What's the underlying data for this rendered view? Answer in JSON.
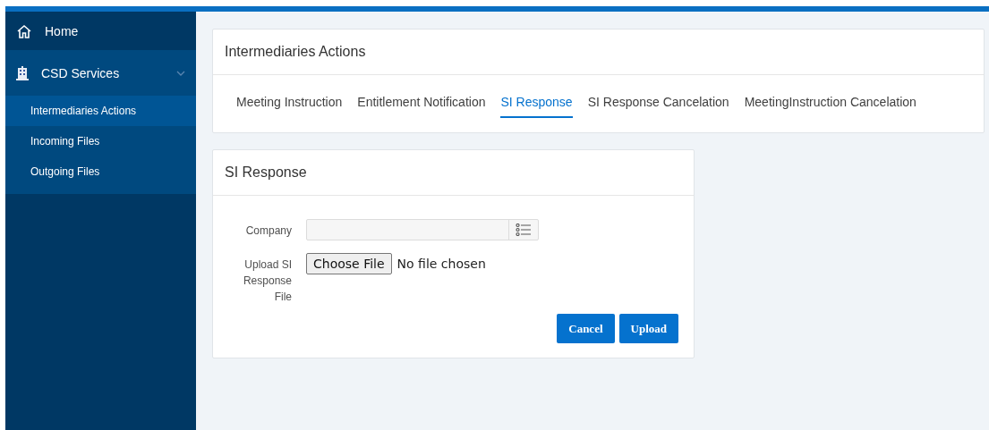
{
  "sidebar": {
    "items": [
      {
        "kind": "link",
        "label": "Home"
      },
      {
        "kind": "group",
        "label": "CSD Services",
        "expanded": true,
        "children": [
          {
            "label": "Intermediaries Actions",
            "selected": true
          },
          {
            "label": "Incoming Files",
            "selected": false
          },
          {
            "label": "Outgoing Files",
            "selected": false
          }
        ]
      }
    ]
  },
  "actions_card": {
    "title": "Intermediaries Actions",
    "tabs": [
      {
        "label": "Meeting Instruction",
        "selected": false
      },
      {
        "label": "Entitlement Notification",
        "selected": false
      },
      {
        "label": "SI Response",
        "selected": true
      },
      {
        "label": "SI Response Cancelation",
        "selected": false
      },
      {
        "label": "MeetingInstruction Cancelation",
        "selected": false
      }
    ]
  },
  "form_card": {
    "title": "SI Response",
    "fields": [
      {
        "kind": "lov",
        "label": "Company"
      },
      {
        "kind": "file",
        "label": "Upload SI Response File",
        "button": "Choose File",
        "value": "No file chosen"
      }
    ],
    "buttons": [
      "Cancel",
      "Upload"
    ]
  }
}
